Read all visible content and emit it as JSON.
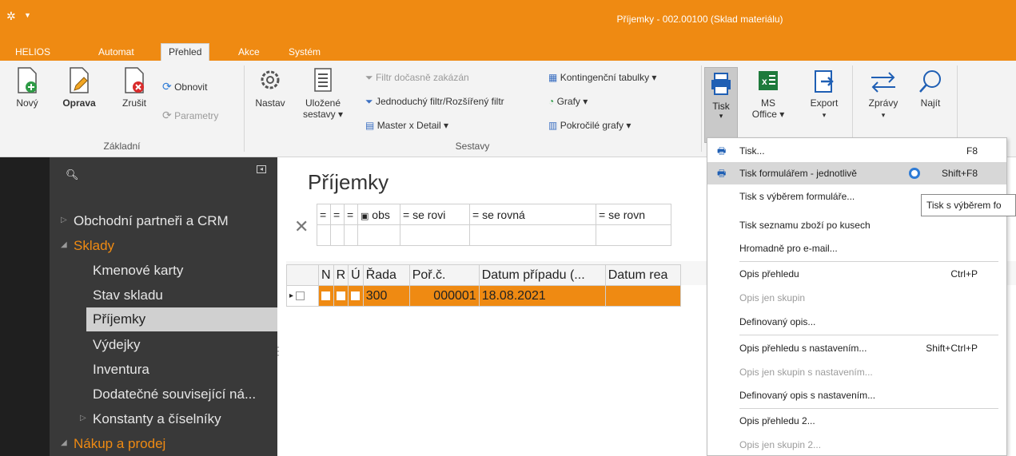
{
  "window": {
    "title": "Příjemky - 002.00100 (Sklad materiálu)"
  },
  "menu_tabs": [
    "HELIOS",
    "Automat",
    "Přehled",
    "Akce",
    "Systém"
  ],
  "ribbon": {
    "zakladni": {
      "new": "Nový",
      "edit": "Oprava",
      "cancel": "Zrušit",
      "refresh": "Obnovit",
      "params": "Parametry",
      "label": "Základní"
    },
    "nastav": "Nastav",
    "ulozene": [
      "Uložené",
      "sestavy ▾"
    ],
    "sestavy": {
      "filter_disabled": "Filtr dočasně zakázán",
      "simple_filter": "Jednoduchý filtr/Rozšířený filtr",
      "master_detail": "Master x Detail ▾",
      "pivot": "Kontingenční tabulky ▾",
      "charts": "Grafy ▾",
      "adv_charts": "Pokročilé grafy ▾",
      "label": "Sestavy"
    },
    "tisk": [
      "Tisk",
      "▾"
    ],
    "ms_office": [
      "MS",
      "Office ▾"
    ],
    "export": [
      "Export",
      "▾"
    ],
    "zpravy": [
      "Zprávy",
      "▾"
    ],
    "najit": "Najít"
  },
  "sidebar": {
    "items": [
      {
        "label": "Obchodní partneři a CRM"
      },
      {
        "label": "Sklady"
      },
      {
        "label": "Kmenové karty"
      },
      {
        "label": "Stav skladu"
      },
      {
        "label": "Příjemky"
      },
      {
        "label": "Výdejky"
      },
      {
        "label": "Inventura"
      },
      {
        "label": "Dodatečné související ná..."
      },
      {
        "label": "Konstanty a číselníky"
      },
      {
        "label": "Nákup a prodej"
      }
    ]
  },
  "content": {
    "title": "Příjemky",
    "filter_ops": [
      "=",
      "=",
      "=",
      "obs",
      "= se rovi",
      "= se rovná",
      "= se rovn"
    ],
    "columns": [
      "N",
      "R",
      "Ú",
      "Řada",
      "Poř.č.",
      "Datum případu (...",
      "Datum rea"
    ],
    "rows": [
      {
        "rada": "300",
        "porc": "000001",
        "datum": "18.08.2021"
      }
    ]
  },
  "dropdown": {
    "items": [
      {
        "label": "Tisk...",
        "shortcut": "F8"
      },
      {
        "label": "Tisk formulářem - jednotlivě",
        "shortcut": "Shift+F8"
      },
      {
        "label": "Tisk s výběrem formuláře..."
      },
      {
        "label": "Tisk seznamu zboží po kusech"
      },
      {
        "label": "Hromadně pro e-mail..."
      },
      {
        "label": "Opis přehledu",
        "shortcut": "Ctrl+P"
      },
      {
        "label": "Opis jen skupin"
      },
      {
        "label": "Definovaný opis..."
      },
      {
        "label": "Opis přehledu s nastavením...",
        "shortcut": "Shift+Ctrl+P"
      },
      {
        "label": "Opis jen skupin s nastavením..."
      },
      {
        "label": "Definovaný opis s nastavením..."
      },
      {
        "label": "Opis přehledu 2..."
      },
      {
        "label": "Opis jen skupin 2..."
      }
    ],
    "tooltip": "Tisk s výběrem fo"
  },
  "colors": {
    "accent": "#ef8a12",
    "sidebar_bg": "#393939"
  }
}
